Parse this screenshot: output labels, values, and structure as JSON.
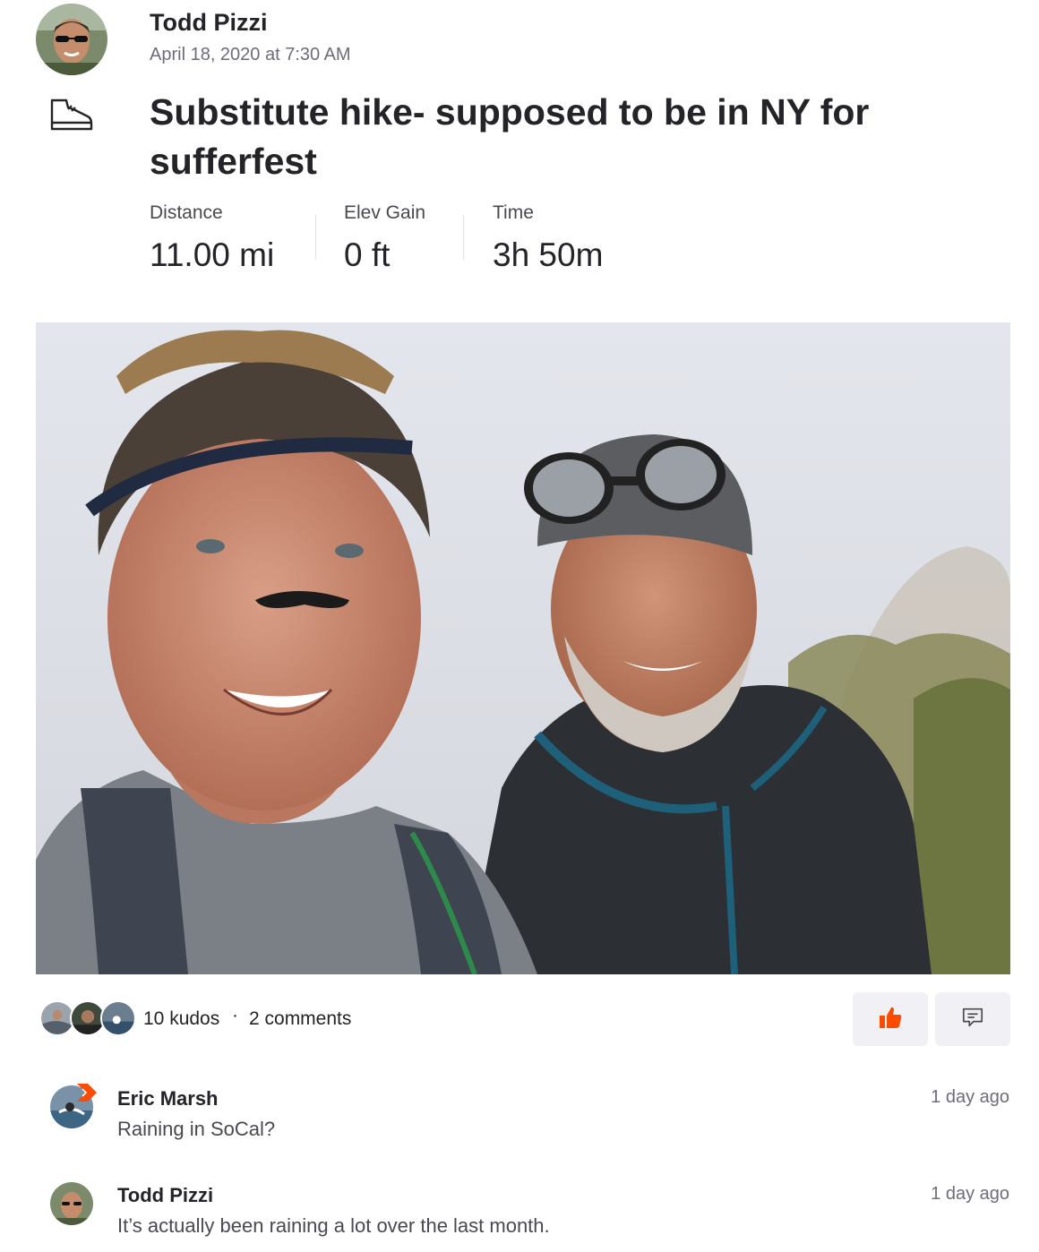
{
  "header": {
    "athlete_name": "Todd Pizzi",
    "date": "April 18, 2020 at 7:30 AM",
    "sport_icon": "hiking-boot-icon"
  },
  "activity": {
    "title": "Substitute hike- supposed to be in NY for sufferfest",
    "stats": [
      {
        "label": "Distance",
        "value": "11.00 mi"
      },
      {
        "label": "Elev Gain",
        "value": "0 ft"
      },
      {
        "label": "Time",
        "value": "3h 50m"
      }
    ]
  },
  "social": {
    "kudos": "10 kudos",
    "separator": "·",
    "comments": "2 comments",
    "kudos_button_icon": "thumbs-up-icon",
    "comment_button_icon": "comment-icon",
    "accent_color": "#fc4c02"
  },
  "comments": [
    {
      "name": "Eric Marsh",
      "text": "Raining in SoCal?",
      "time": "1 day ago"
    },
    {
      "name": "Todd Pizzi",
      "text": "It’s actually been raining a lot over the last month.",
      "time": "1 day ago"
    }
  ]
}
